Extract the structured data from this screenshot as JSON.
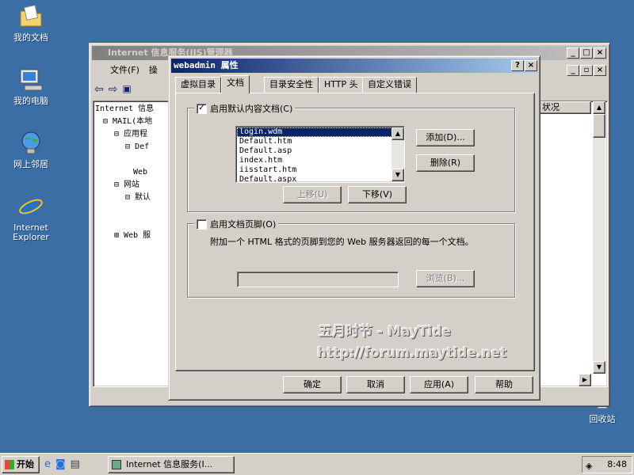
{
  "desktop": {
    "icons": [
      {
        "label": "我的文档",
        "icon": "folder-documents-icon"
      },
      {
        "label": "我的电脑",
        "icon": "computer-icon"
      },
      {
        "label": "网上邻居",
        "icon": "network-icon"
      },
      {
        "label": "Internet Explorer",
        "icon": "ie-icon"
      },
      {
        "label": "回收站",
        "icon": "recycle-bin-icon"
      }
    ]
  },
  "iis_window": {
    "title": "Internet 信息服务(IIS)管理器",
    "menu": [
      "文件(F)",
      "操"
    ],
    "tree": [
      {
        "label": "Internet 信息",
        "level": 0
      },
      {
        "label": "MAIL(本地",
        "level": 1
      },
      {
        "label": "应用程",
        "level": 2
      },
      {
        "label": "Def",
        "level": 3
      },
      {
        "label": "Web",
        "level": 3
      },
      {
        "label": "网站",
        "level": 2
      },
      {
        "label": "默认",
        "level": 3
      },
      {
        "label": "Web 服",
        "level": 2
      }
    ],
    "column_header": "状况"
  },
  "dialog": {
    "title": "webadmin 属性",
    "help_btn": "?",
    "close_btn": "×",
    "tabs": [
      "虚拟目录",
      "文档",
      "目录安全性",
      "HTTP 头",
      "自定义错误"
    ],
    "active_tab": "文档",
    "default_docs_group": {
      "checkbox_label": "启用默认内容文档(C)",
      "checked": true,
      "docs": [
        "login.wdm",
        "Default.htm",
        "Default.asp",
        "index.htm",
        "iisstart.htm",
        "Default.aspx"
      ],
      "selected_index": 0,
      "add_btn": "添加(D)...",
      "remove_btn": "删除(R)",
      "move_up_btn": "上移(U)",
      "move_down_btn": "下移(V)"
    },
    "footer_group": {
      "checkbox_label": "启用文档页脚(O)",
      "checked": false,
      "description": "附加一个 HTML 格式的页脚到您的 Web 服务器返回的每一个文档。",
      "path_value": "",
      "browse_btn": "浏览(B)..."
    },
    "buttons": {
      "ok": "确定",
      "cancel": "取消",
      "apply": "应用(A)",
      "help": "帮助"
    }
  },
  "watermark": {
    "line1": "五月时节 - MayTide",
    "line2": "http://forum.maytide.net"
  },
  "taskbar": {
    "start": "开始",
    "task": "Internet 信息服务(I...",
    "clock": "8:48"
  }
}
